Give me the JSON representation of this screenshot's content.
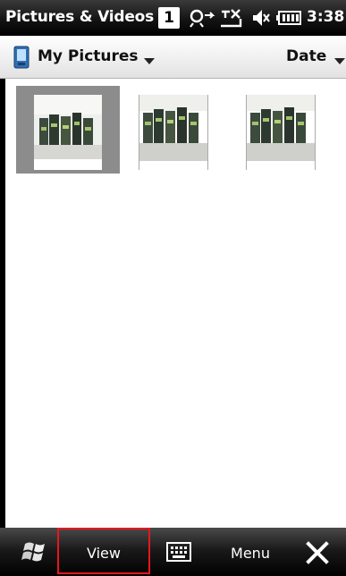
{
  "title_bar": {
    "app_title": "Pictures & Videos",
    "notification_count": "1",
    "icons": [
      "sync-icon",
      "signal-off-icon",
      "speaker-muted-icon",
      "battery-icon"
    ],
    "clock": "3:38"
  },
  "header": {
    "folder_label": "My Pictures",
    "sort_label": "Date"
  },
  "thumbnails": [
    {
      "name": "picture-1",
      "selected": true
    },
    {
      "name": "picture-2",
      "selected": false
    },
    {
      "name": "picture-3",
      "selected": false
    }
  ],
  "softkeys": {
    "left_label": "View",
    "right_label": "Menu",
    "highlight_color": "#e8171c"
  },
  "colors": {
    "titlebar": "#141414",
    "selection": "#8c8c8c"
  }
}
